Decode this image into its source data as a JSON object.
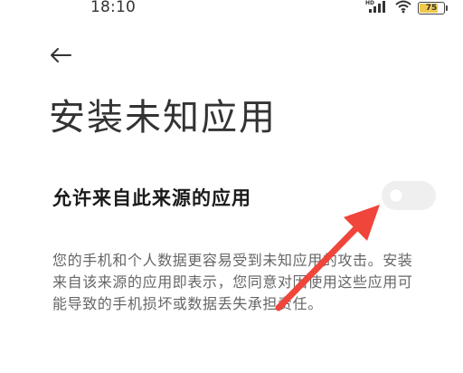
{
  "status_bar": {
    "time": "18:10",
    "battery_level": "75",
    "battery_fraction": 0.75,
    "icons": [
      "hd-icon",
      "signal-icon",
      "wifi-icon",
      "battery-icon"
    ]
  },
  "header": {
    "back_icon": "arrow-left-icon"
  },
  "page": {
    "title": "安装未知应用"
  },
  "setting": {
    "label": "允许来自此来源的应用",
    "toggle_state": "off"
  },
  "description": {
    "text": "您的手机和个人数据更容易受到未知应用的攻击。安装来自该来源的应用即表示，您同意对因使用这些应用可能导致的手机损坏或数据丢失承担责任。"
  },
  "colors": {
    "annotation_arrow": "#f0453a",
    "battery_fill": "#f2c94c",
    "toggle_off_bg": "#efefef"
  }
}
